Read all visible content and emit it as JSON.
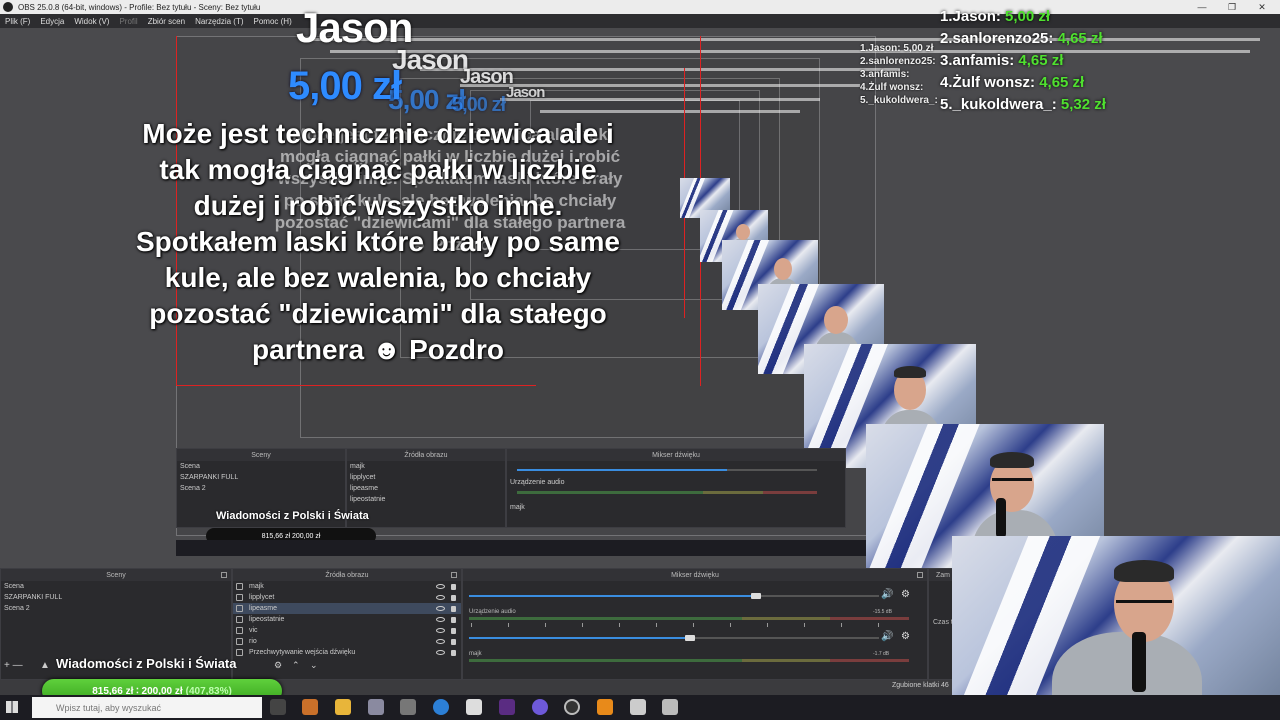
{
  "window": {
    "title": "OBS 25.0.8 (64-bit, windows) - Profile: Bez tytułu - Sceny: Bez tytułu",
    "minimize": "—",
    "maximize": "❐",
    "close": "✕"
  },
  "menu": {
    "items": [
      "Plik (F)",
      "Edycja",
      "Widok (V)",
      "Profil",
      "Zbiór scen",
      "Narzędzia (T)",
      "Pomoc (H)"
    ]
  },
  "alert": {
    "name": "Jason",
    "amount": "5,00 zł",
    "message": "Może jest technicznie dziewica ale i tak mogła ciągnąć pałki w liczbie dużej i robić wszystko inne. Spotkałem laski które brały po same kule, ale bez walenia, bo chciały pozostać \"dziewicami\" dla stałego partnera ☻ Pozdro"
  },
  "top_donors": [
    {
      "rank": "1.",
      "name": "Jason:",
      "amount": "5,00 zł"
    },
    {
      "rank": "2.",
      "name": "sanlorenzo25:",
      "amount": "4,65 zł"
    },
    {
      "rank": "3.",
      "name": "anfamis:",
      "amount": "4,65 zł"
    },
    {
      "rank": "4.",
      "name": "Żulf wonsz:",
      "amount": "4,65 zł"
    },
    {
      "rank": "5.",
      "name": "_kukoldwera_:",
      "amount": "5,32 zł"
    }
  ],
  "docks": {
    "scenes": {
      "title": "Sceny",
      "items": [
        "Scena",
        "SZARPANKI FULL",
        "Scena 2"
      ]
    },
    "sources": {
      "title": "Źródła obrazu",
      "items": [
        "majk",
        "lipplycet",
        "lipeasme",
        "lipeostatnie",
        "vic",
        "rio",
        "Przechwytywanie wejścia dźwięku"
      ]
    },
    "mixer": {
      "title": "Mikser dźwięku",
      "track1": "Urządzenie audio",
      "track1_db": "-15.5 dB",
      "track2": "majk",
      "track2_db": "-1.7 dB"
    },
    "extra": {
      "title": "Zam",
      "label": "Czas t"
    }
  },
  "scene_overlay_title": "Wiadomości z Polski i Świata",
  "goal": {
    "text": "815,66 zł ∶ 200,00 zł",
    "percent": "(407,83%)",
    "fraction": 4.0783
  },
  "nested_goal_text": "815,66 zł  200,00 zł",
  "status_bar": "Zgubione klatki 46",
  "taskbar": {
    "search_placeholder": "Wpisz tutaj, aby wyszukać"
  }
}
